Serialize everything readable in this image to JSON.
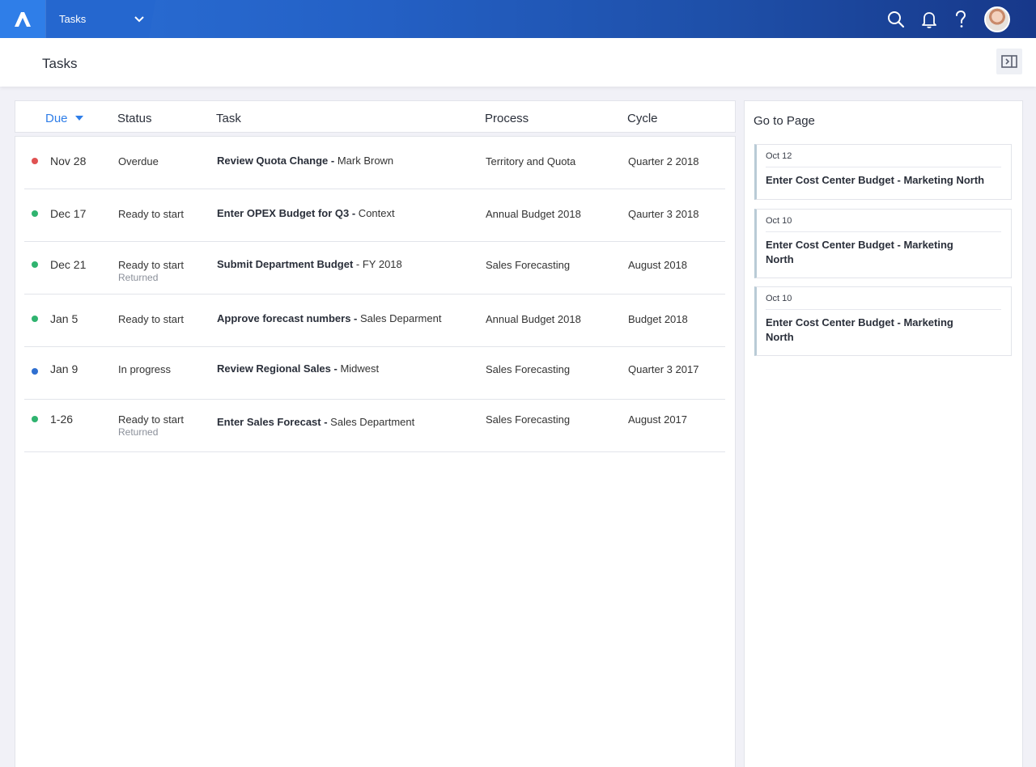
{
  "app": {
    "selector_label": "Tasks"
  },
  "header": {
    "title": "Tasks"
  },
  "colors": {
    "overdue": "#e05252",
    "ready": "#2fb36f",
    "in_progress": "#2f6fd0",
    "accent": "#2f7ee8"
  },
  "icons": [
    "app-logo-icon",
    "chevron-down-icon",
    "search-icon",
    "bell-icon",
    "help-icon",
    "panel-toggle-icon",
    "sort-down-icon"
  ],
  "table": {
    "columns": {
      "due": "Due",
      "status": "Status",
      "task": "Task",
      "process": "Process",
      "cycle": "Cycle"
    },
    "rows": [
      {
        "due": "Nov 28",
        "status": "Overdue",
        "status_sub": "",
        "task_bold": "Review Quota Change -",
        "task_rest": " Mark Brown",
        "process": "Territory and Quota",
        "cycle": "Quarter 2 2018",
        "dot": "overdue"
      },
      {
        "due": "Dec 17",
        "status": "Ready to start",
        "status_sub": "",
        "task_bold": "Enter OPEX Budget for Q3 -",
        "task_rest": " Context",
        "process": "Annual Budget 2018",
        "cycle": "Qaurter 3 2018",
        "dot": "ready"
      },
      {
        "due": "Dec 21",
        "status": "Ready to start",
        "status_sub": "Returned",
        "task_bold": "Submit Department Budget",
        "task_rest": " - FY 2018",
        "process": "Sales Forecasting",
        "cycle": "August 2018",
        "dot": "ready"
      },
      {
        "due": "Jan 5",
        "status": "Ready to start",
        "status_sub": "",
        "task_bold": "Approve forecast numbers -",
        "task_rest": " Sales Deparment",
        "process": "Annual Budget 2018",
        "cycle": "Budget 2018",
        "dot": "ready"
      },
      {
        "due": "Jan 9",
        "status": "In progress",
        "status_sub": "",
        "task_bold": "Review Regional Sales -",
        "task_rest": " Midwest",
        "process": "Sales Forecasting",
        "cycle": "Quarter 3 2017",
        "dot": "in_progress"
      },
      {
        "due": "1-26",
        "status": "Ready to start",
        "status_sub": "Returned",
        "task_bold": "Enter Sales Forecast -",
        "task_rest": " Sales Department",
        "process": "Sales Forecasting",
        "cycle": "August 2017",
        "dot": "ready"
      }
    ]
  },
  "goto_panel": {
    "title": "Go to Page",
    "cards": [
      {
        "date": "Oct 12",
        "title": "Enter Cost Center Budget - Marketing North"
      },
      {
        "date": "Oct 10",
        "title": "Enter Cost Center Budget - Marketing North"
      },
      {
        "date": "Oct 10",
        "title": "Enter Cost Center Budget - Marketing North"
      }
    ]
  }
}
